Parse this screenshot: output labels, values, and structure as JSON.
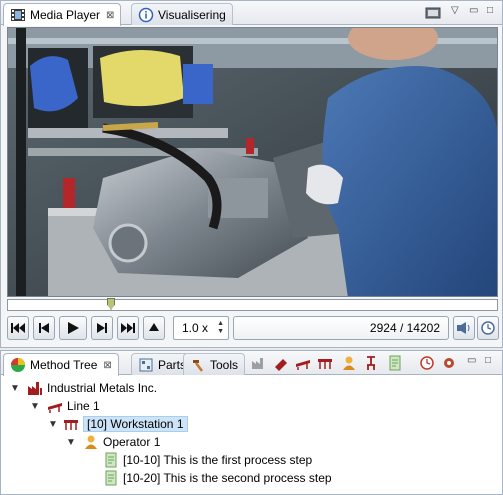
{
  "player_tabs": [
    {
      "label": "Media Player",
      "close": "⊠"
    },
    {
      "label": "Visualisering"
    }
  ],
  "player": {
    "speed": "1.0 x",
    "frame_position": "2924 / 14202",
    "current_frame": 2924,
    "total_frames": 14202,
    "seek_fraction": 0.206
  },
  "tree_tabs": [
    {
      "label": "Method Tree",
      "close": "⊠"
    },
    {
      "label": "Parts"
    },
    {
      "label": "Tools"
    }
  ],
  "tree": {
    "company": "Industrial Metals Inc.",
    "line": "Line 1",
    "workstation": "[10] Workstation 1",
    "operator": "Operator 1",
    "steps": [
      "[10-10] This is the first process step",
      "[10-20] This is the second process step"
    ]
  },
  "icons": {
    "expand_open": "▼",
    "menu": "▽",
    "minimize": "▭",
    "maximize": "□"
  },
  "colors": {
    "selection": "#cde4f7",
    "accent": "#2f62c0"
  }
}
